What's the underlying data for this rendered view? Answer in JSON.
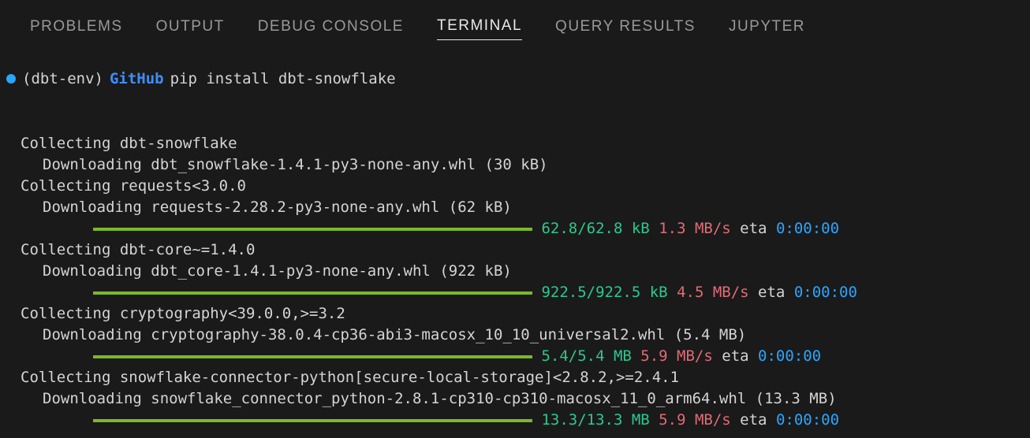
{
  "tabs": {
    "problems": "PROBLEMS",
    "output": "OUTPUT",
    "debug_console": "DEBUG CONSOLE",
    "terminal": "TERMINAL",
    "query_results": "QUERY RESULTS",
    "jupyter": "JUPYTER"
  },
  "prompt": {
    "env": "(dbt-env)",
    "path": "GitHub",
    "cmd": "pip install dbt-snowflake"
  },
  "lines": {
    "c1": "Collecting dbt-snowflake",
    "d1": "Downloading dbt_snowflake-1.4.1-py3-none-any.whl (30 kB)",
    "c2": "Collecting requests<3.0.0",
    "d2": "Downloading requests-2.28.2-py3-none-any.whl (62 kB)",
    "p2_size": "62.8/62.8 kB",
    "p2_speed": "1.3 MB/s",
    "p2_eta_lbl": "eta",
    "p2_eta": "0:00:00",
    "c3": "Collecting dbt-core~=1.4.0",
    "d3": "Downloading dbt_core-1.4.1-py3-none-any.whl (922 kB)",
    "p3_size": "922.5/922.5 kB",
    "p3_speed": "4.5 MB/s",
    "p3_eta_lbl": "eta",
    "p3_eta": "0:00:00",
    "c4": "Collecting cryptography<39.0.0,>=3.2",
    "d4": "Downloading cryptography-38.0.4-cp36-abi3-macosx_10_10_universal2.whl (5.4 MB)",
    "p4_size": "5.4/5.4 MB",
    "p4_speed": "5.9 MB/s",
    "p4_eta_lbl": "eta",
    "p4_eta": "0:00:00",
    "c5": "Collecting snowflake-connector-python[secure-local-storage]<2.8.2,>=2.4.1",
    "d5": "Downloading snowflake_connector_python-2.8.1-cp310-cp310-macosx_11_0_arm64.whl (13.3 MB)",
    "p5_size": "13.3/13.3 MB",
    "p5_speed": "5.9 MB/s",
    "p5_eta_lbl": "eta",
    "p5_eta": "0:00:00"
  }
}
